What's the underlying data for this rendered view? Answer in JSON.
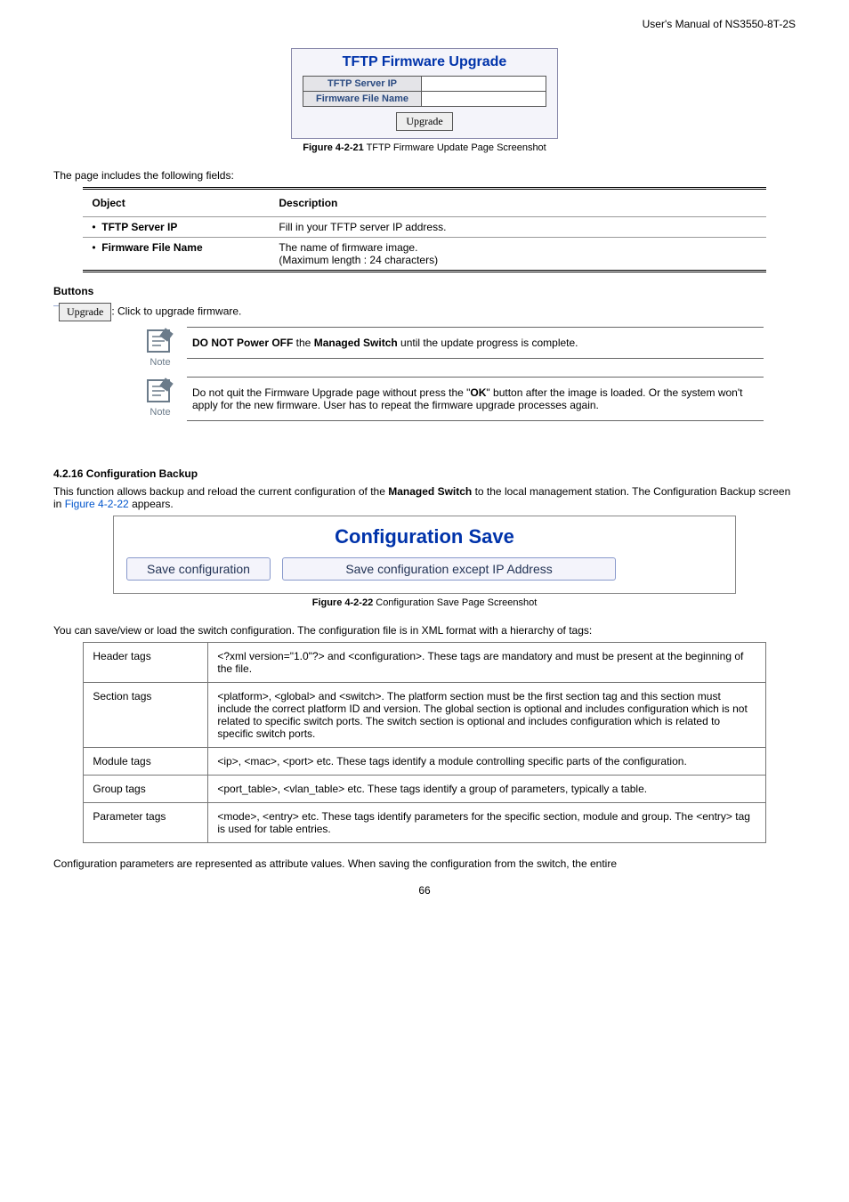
{
  "header": {
    "manual": "User's Manual of NS3550-8T-2S"
  },
  "tftp_widget": {
    "title": "TFTP Firmware Upgrade",
    "row1": "TFTP Server IP",
    "row2": "Firmware File Name",
    "button": "Upgrade",
    "fig_label": "Figure 4-2-21",
    "caption_suffix": "TFTP Firmware Update Page Screenshot"
  },
  "fields_intro": "The page includes the following fields:",
  "obj_table": {
    "h1": "Object",
    "h2": "Description",
    "r1_obj": "TFTP Server IP",
    "r1_desc": "Fill in your TFTP server IP address.",
    "r2_obj": "Firmware File Name",
    "r2_desc_a": "The name of firmware image.",
    "r2_desc_b": "(Maximum length : 24 characters)"
  },
  "buttons_label": "Buttons",
  "upgrade_desc": ": Click to upgrade firmware.",
  "note1": {
    "pre": "DO NOT Power OFF",
    "mid": " the ",
    "bold": "Managed Switch",
    "post": " until the update progress is complete."
  },
  "note2": {
    "a": "Do not quit the Firmware Upgrade page without press the \"",
    "b": "OK",
    "c": "\" button after the image is loaded. Or the system won't apply for the new firmware. User has to repeat the firmware upgrade processes again."
  },
  "note_label": "Note",
  "section_title": "4.2.16 Configuration Backup",
  "section_intro_a": "This function allows backup and reload the current configuration of the ",
  "section_intro_bold": "Managed Switch",
  "section_intro_b": " to the local management station. The Configuration Backup screen in ",
  "section_intro_link": "Figure 4-2-22",
  "section_intro_c": " appears.",
  "cs_widget": {
    "title": "Configuration Save",
    "btn1": "Save configuration",
    "btn2": "Save configuration except IP Address",
    "fig_label": "Figure 4-2-22",
    "caption_suffix": "Configuration Save Page Screenshot"
  },
  "xml_intro": "You can save/view or load the switch configuration. The configuration file is in XML format with a hierarchy of tags:",
  "xml_rows": [
    {
      "name": "Header tags",
      "desc": "<?xml version=\"1.0\"?> and <configuration>. These tags are mandatory and must be present at the beginning of the file."
    },
    {
      "name": "Section tags",
      "desc": "<platform>, <global> and <switch>. The platform section must be the first section tag and this section must include the correct platform ID and version. The global section is optional and includes configuration which is not related to specific switch ports. The switch section is optional and includes configuration which is related to specific switch ports."
    },
    {
      "name": "Module tags",
      "desc": "<ip>, <mac>, <port> etc. These tags identify a module controlling specific parts of the configuration."
    },
    {
      "name": "Group tags",
      "desc": "<port_table>, <vlan_table> etc. These tags identify a group of parameters, typically a table."
    },
    {
      "name": "Parameter tags",
      "desc": "<mode>, <entry> etc. These tags identify parameters for the specific section, module and group. The <entry> tag is used for table entries."
    }
  ],
  "trailing": "Configuration parameters are represented as attribute values. When saving the configuration from the switch, the entire",
  "page_num": "66"
}
